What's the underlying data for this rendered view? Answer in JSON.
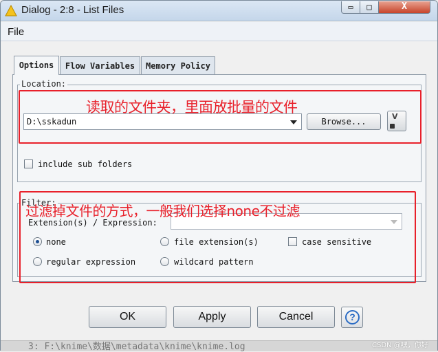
{
  "window": {
    "title": "Dialog - 2:8 - List Files",
    "controls": {
      "minimize": "▭",
      "maximize": "□",
      "close": "X"
    }
  },
  "menu": {
    "file": "File"
  },
  "tabs": [
    {
      "label": "Options",
      "active": true
    },
    {
      "label": "Flow Variables",
      "active": false
    },
    {
      "label": "Memory Policy",
      "active": false
    }
  ],
  "location": {
    "group_label": "Location:",
    "path_value": "D:\\sskadun",
    "browse_label": "Browse...",
    "flow_var_button": "V",
    "include_sub_folders_label": "include sub folders",
    "include_sub_folders_checked": false
  },
  "filter": {
    "group_label": "Filter:",
    "extension_label": "Extension(s) / Expression:",
    "extension_value": "",
    "options": {
      "none": {
        "label": "none",
        "checked": true
      },
      "file_extension": {
        "label": "file extension(s)",
        "checked": false
      },
      "regular_expression": {
        "label": "regular expression",
        "checked": false
      },
      "wildcard_pattern": {
        "label": "wildcard pattern",
        "checked": false
      }
    },
    "case_sensitive_label": "case sensitive",
    "case_sensitive_checked": false
  },
  "annotations": {
    "location_note": "读取的文件夹，里面放批量的文件",
    "filter_note": "过滤掉文件的方式，一般我们选择none不过滤",
    "color": "#e8202a"
  },
  "buttons": {
    "ok": "OK",
    "apply": "Apply",
    "cancel": "Cancel",
    "help": "?"
  },
  "background_text": "3:  F:\\knime\\数据\\metadata\\knime\\knime.log",
  "watermark": "CSDN @嘿，你好",
  "colors": {
    "annotation_red": "#e8202a",
    "radio_dot": "#1c4e92",
    "help_blue": "#2b6cc4"
  }
}
